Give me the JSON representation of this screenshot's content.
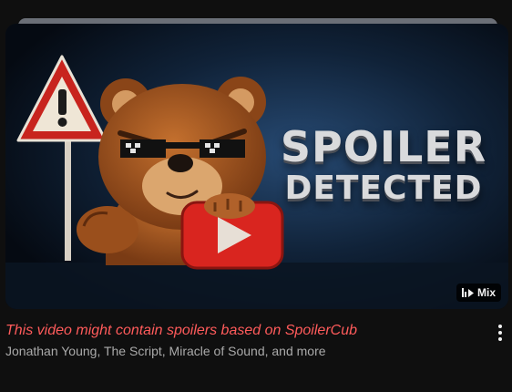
{
  "video": {
    "thumbnail": {
      "headline_line1": "SPOILER",
      "headline_line2": "DETECTED",
      "icons": [
        "warning-sign-icon",
        "bear-mascot-icon",
        "play-button-icon"
      ]
    },
    "badge_label": "Mix",
    "badge_icon": "mix-playlist-icon",
    "title": "This video might contain spoilers based on SpoilerCub",
    "subtitle": "Jonathan Young, The Script, Miracle of Sound, and more",
    "menu_icon": "more-vertical-icon"
  },
  "colors": {
    "background": "#0f0f0f",
    "title": "#ff5b5b",
    "subtitle": "#aaaaaa",
    "play_red": "#d9251f"
  }
}
